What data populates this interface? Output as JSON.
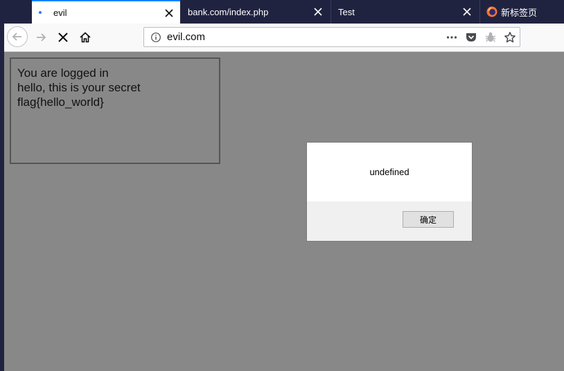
{
  "browser": {
    "tabs": [
      {
        "label": "evil",
        "active": true
      },
      {
        "label": "bank.com/index.php",
        "active": false
      },
      {
        "label": "Test",
        "active": false
      },
      {
        "label": "新标签页",
        "active": false,
        "icon": "firefox-icon"
      }
    ],
    "urlbar": {
      "url": "evil.com",
      "icon": "info-icon"
    },
    "nav_icons": [
      "back-arrow-icon",
      "forward-arrow-icon",
      "stop-x-icon",
      "home-icon"
    ],
    "url_actions": [
      "page-actions-dots-icon",
      "pocket-icon",
      "tracking-protection-icon",
      "bookmark-star-icon"
    ],
    "colors": {
      "tabstrip": "#202340",
      "accent": "#0a84ff",
      "page_background": "#888888"
    }
  },
  "page": {
    "lines": [
      "You are logged in",
      "hello, this is your secret",
      "flag{hello_world}"
    ]
  },
  "dialog": {
    "message": "undefined",
    "ok_label": "确定"
  }
}
